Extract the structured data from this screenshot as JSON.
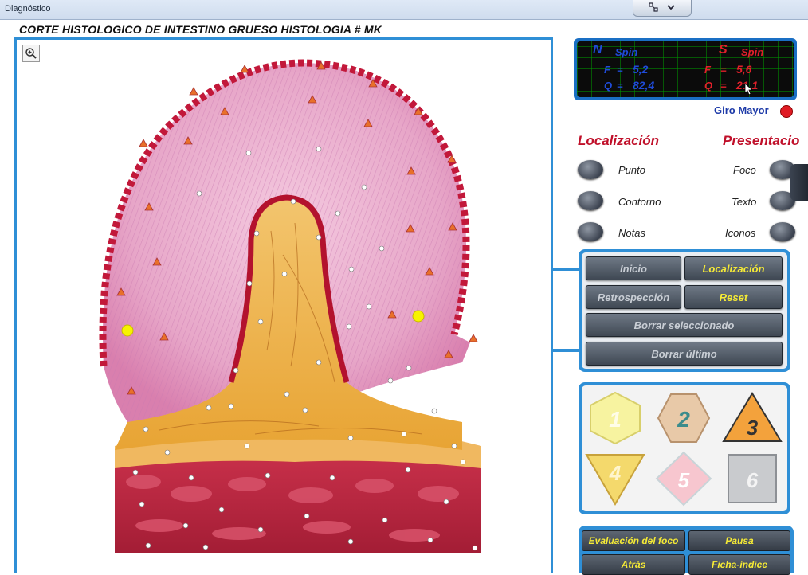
{
  "window": {
    "title": "Diagnóstico"
  },
  "header": {
    "title": "CORTE HISTOLOGICO DE INTESTINO GRUESO HISTOLOGIA # MK"
  },
  "spin": {
    "n_label": "N",
    "n_spin": "Spin",
    "n_f_label": "F",
    "n_f_value": "5,2",
    "n_q_label": "Q",
    "n_q_value": "82,4",
    "s_label": "S",
    "s_spin": "Spin",
    "s_f_label": "F",
    "s_f_value": "5,6",
    "s_q_label": "Q",
    "s_q_value": "21,1"
  },
  "giro": {
    "label": "Giro Mayor"
  },
  "localizacion": {
    "title": "Localización",
    "options": [
      "Punto",
      "Contorno",
      "Notas"
    ]
  },
  "presentacion": {
    "title": "Presentacio",
    "options": [
      "Foco",
      "Texto",
      "Iconos"
    ]
  },
  "commands": {
    "inicio": "Inicio",
    "localizacion": "Localización",
    "retrospeccion": "Retrospección",
    "reset": "Reset",
    "borrar_seleccionado": "Borrar seleccionado",
    "borrar_ultimo": "Borrar último"
  },
  "shapes": [
    {
      "num": "1",
      "shape": "hexagon",
      "color": "#f7f3a0"
    },
    {
      "num": "2",
      "shape": "hexagon",
      "color": "#e8c9a8"
    },
    {
      "num": "3",
      "shape": "triangle-up",
      "color": "#f3a23c"
    },
    {
      "num": "4",
      "shape": "triangle-down",
      "color": "#f4d96c"
    },
    {
      "num": "5",
      "shape": "diamond",
      "color": "#f7c6cf"
    },
    {
      "num": "6",
      "shape": "square",
      "color": "#c9cbce"
    }
  ],
  "nav": {
    "evaluacion": "Evaluación del foco",
    "pausa": "Pausa",
    "atras": "Atrás",
    "ficha": "Ficha-índice"
  },
  "colors": {
    "accent": "#2f8fd6",
    "red_title": "#c0102a",
    "yellow_text": "#f5ea36"
  }
}
